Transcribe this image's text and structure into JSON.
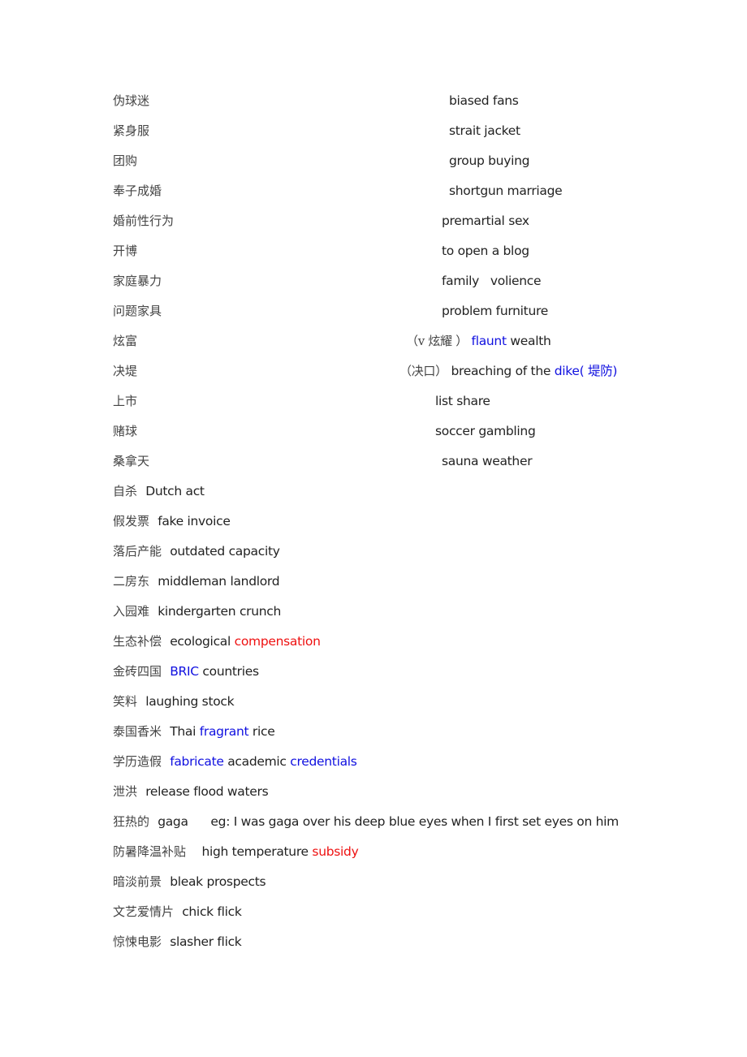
{
  "colors": {
    "text": "#222222",
    "chinese": "#444444",
    "blue": "#1010e0",
    "red": "#ee1111"
  },
  "two_column_entries": [
    {
      "zh": "伪球迷",
      "en": [
        {
          "text": "biased fans",
          "style": "normal"
        }
      ]
    },
    {
      "zh": "紧身服",
      "en": [
        {
          "text": "strait jacket",
          "style": "normal"
        }
      ]
    },
    {
      "zh": "团购",
      "en": [
        {
          "text": "group buying",
          "style": "normal"
        }
      ]
    },
    {
      "zh": "奉子成婚",
      "en": [
        {
          "text": "shortgun marriage",
          "style": "normal"
        }
      ]
    },
    {
      "zh": "婚前性行为",
      "en": [
        {
          "text": "premartial sex",
          "style": "normal"
        }
      ]
    },
    {
      "zh": "开博",
      "en": [
        {
          "text": "to open a blog",
          "style": "normal"
        }
      ]
    },
    {
      "zh": "家庭暴力",
      "en": [
        {
          "text": "family   volience",
          "style": "normal"
        }
      ]
    },
    {
      "zh": "问题家具",
      "en": [
        {
          "text": "problem furniture",
          "style": "normal"
        }
      ]
    },
    {
      "zh": "炫富",
      "en": [
        {
          "text": "（v  炫耀  ）",
          "style": "zh"
        },
        {
          "text": " flaunt",
          "style": "blue"
        },
        {
          "text": " wealth",
          "style": "normal"
        }
      ]
    },
    {
      "zh": "决堤",
      "en": [
        {
          "text": "（决口）",
          "style": "zh"
        },
        {
          "text": " breaching of the ",
          "style": "normal"
        },
        {
          "text": "dike( 堤防)",
          "style": "blue"
        }
      ]
    },
    {
      "zh": "上市",
      "en": [
        {
          "text": "list share",
          "style": "normal"
        }
      ]
    },
    {
      "zh": "赌球",
      "en": [
        {
          "text": "soccer gambling",
          "style": "normal"
        }
      ]
    },
    {
      "zh": "桑拿天",
      "en": [
        {
          "text": "sauna weather",
          "style": "normal"
        }
      ]
    }
  ],
  "inline_entries": [
    {
      "zh": "自杀",
      "en": [
        {
          "text": "Dutch act",
          "style": "normal"
        }
      ]
    },
    {
      "zh": "假发票",
      "en": [
        {
          "text": "fake invoice",
          "style": "normal"
        }
      ]
    },
    {
      "zh": "落后产能",
      "en": [
        {
          "text": "outdated capacity",
          "style": "normal"
        }
      ]
    },
    {
      "zh": "二房东",
      "en": [
        {
          "text": "middleman landlord",
          "style": "normal"
        }
      ]
    },
    {
      "zh": "入园难",
      "en": [
        {
          "text": "kindergarten crunch",
          "style": "normal"
        }
      ]
    },
    {
      "zh": "生态补偿",
      "en": [
        {
          "text": "ecological ",
          "style": "normal"
        },
        {
          "text": "compensation",
          "style": "red"
        }
      ]
    },
    {
      "zh": "金砖四国",
      "en": [
        {
          "text": "BRIC",
          "style": "blue"
        },
        {
          "text": " countries",
          "style": "normal"
        }
      ]
    },
    {
      "zh": "笑料",
      "en": [
        {
          "text": "laughing stock",
          "style": "normal"
        }
      ]
    },
    {
      "zh": "泰国香米",
      "en": [
        {
          "text": "Thai ",
          "style": "normal"
        },
        {
          "text": "fragrant",
          "style": "blue"
        },
        {
          "text": " rice",
          "style": "normal"
        }
      ]
    },
    {
      "zh": "学历造假",
      "en": [
        {
          "text": "fabricate",
          "style": "blue"
        },
        {
          "text": " academic ",
          "style": "normal"
        },
        {
          "text": "credentials",
          "style": "blue"
        }
      ]
    },
    {
      "zh": "泄洪",
      "en": [
        {
          "text": "release flood waters",
          "style": "normal"
        }
      ]
    },
    {
      "zh": "狂热的",
      "en": [
        {
          "text": "gaga      eg: I was gaga over his deep blue eyes when I first set eyes on him",
          "style": "normal"
        }
      ]
    },
    {
      "zh": "防暑降温补贴",
      "en": [
        {
          "text": "  high temperature ",
          "style": "normal"
        },
        {
          "text": "subsidy",
          "style": "red"
        }
      ]
    },
    {
      "zh": "暗淡前景",
      "en": [
        {
          "text": "bleak prospects",
          "style": "normal"
        }
      ]
    },
    {
      "zh": "文艺爱情片",
      "en": [
        {
          "text": "chick flick",
          "style": "normal"
        }
      ]
    },
    {
      "zh": "惊悚电影",
      "en": [
        {
          "text": "slasher flick",
          "style": "normal"
        }
      ]
    }
  ]
}
